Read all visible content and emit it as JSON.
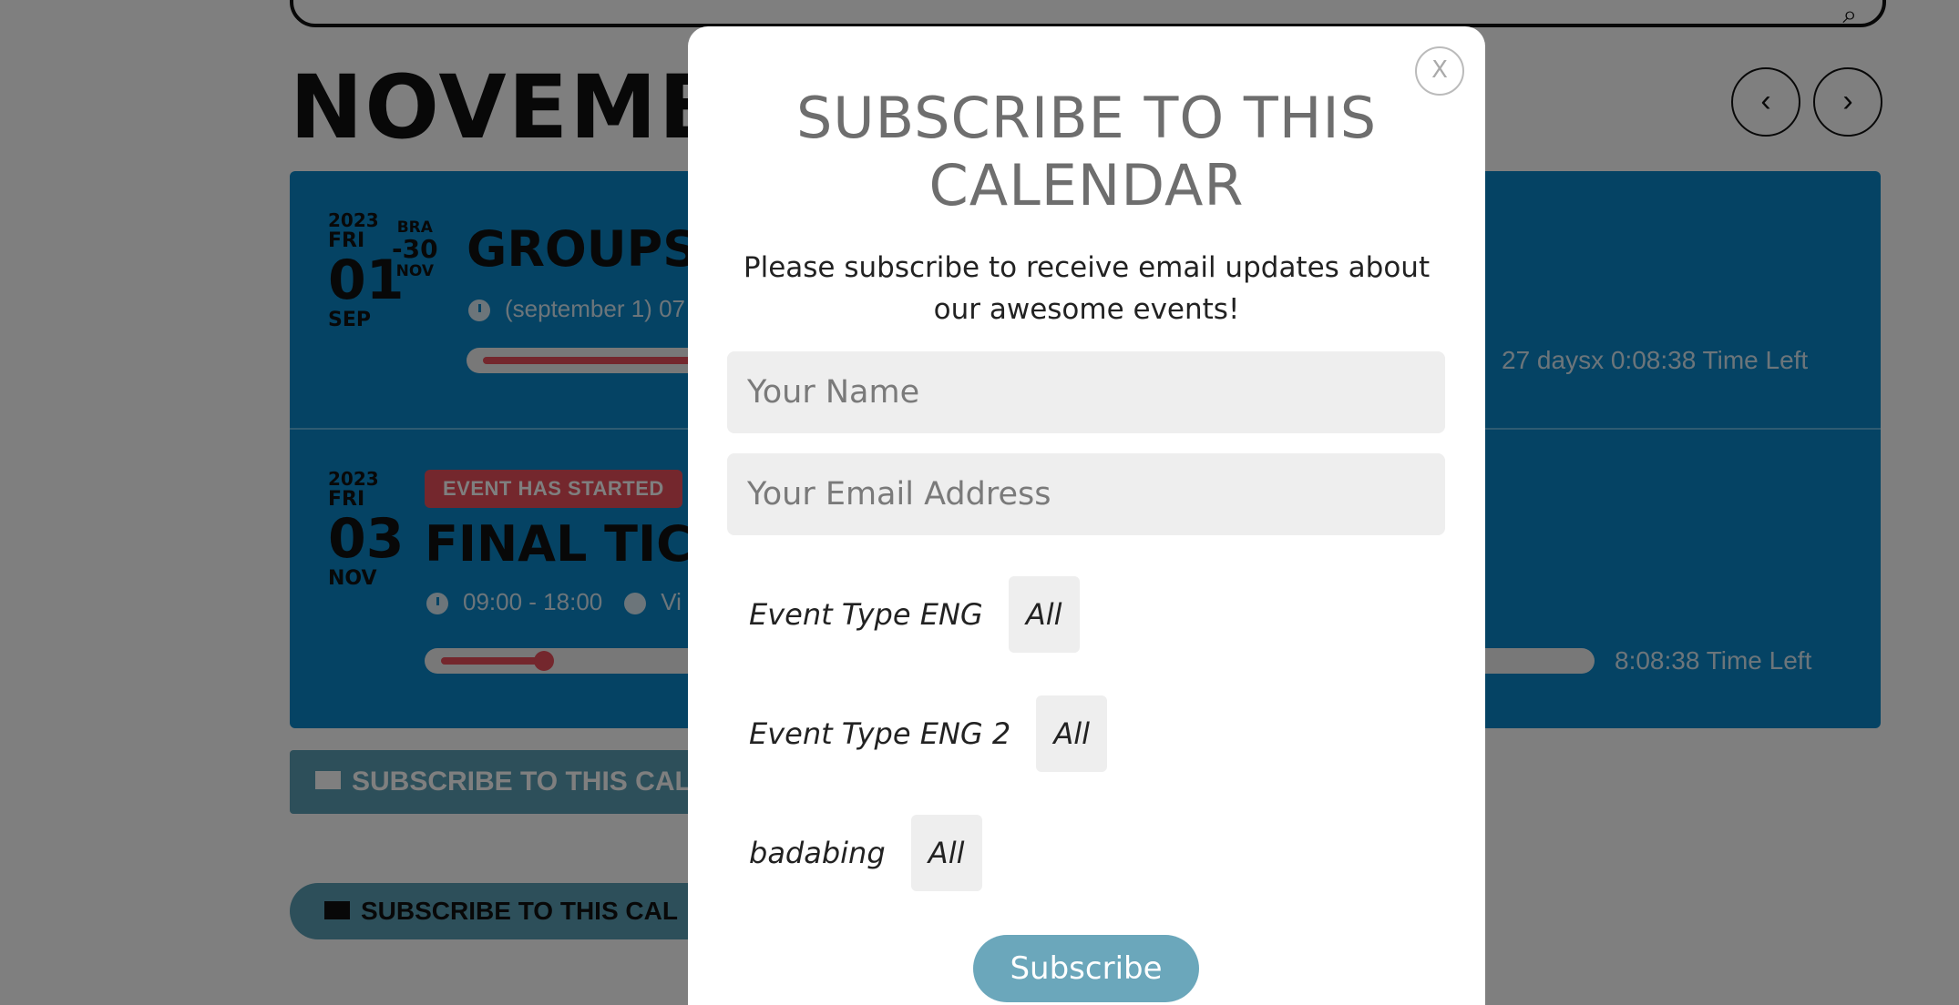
{
  "background": {
    "month_title": "NOVEMB",
    "events": [
      {
        "year": "2023",
        "dow": "FRI",
        "day": "01",
        "month": "SEP",
        "end_top": "BRA",
        "end_day": "-30",
        "end_month": "NOV",
        "title": "GROUPS",
        "meta": "(september 1) 07",
        "time_left": "27 daysx 0:08:38 Time Left"
      },
      {
        "year": "2023",
        "dow": "FRI",
        "day": "03",
        "month": "NOV",
        "badge": "EVENT HAS STARTED",
        "title": "FINAL TICK",
        "time": "09:00 - 18:00",
        "location": "Vi",
        "time_left": "8:08:38 Time Left"
      }
    ],
    "subscribe_button_1": "SUBSCRIBE TO THIS CAL",
    "subscribe_button_2": "SUBSCRIBE TO THIS CAL",
    "nav_prev_icon": "chevron-left-icon",
    "nav_next_icon": "chevron-right-icon"
  },
  "modal": {
    "close_label": "X",
    "title": "SUBSCRIBE TO THIS CALENDAR",
    "description": "Please subscribe to receive email updates about our awesome events!",
    "name_placeholder": "Your Name",
    "email_placeholder": "Your Email Address",
    "filters": [
      {
        "label": "Event Type ENG",
        "value": "All"
      },
      {
        "label": "Event Type ENG 2",
        "value": "All"
      },
      {
        "label": "badabing",
        "value": "All"
      }
    ],
    "subscribe_label": "Subscribe"
  },
  "colors": {
    "event_blue": "#0b87c9",
    "accent_red": "#e94e5a",
    "button_teal": "#6ba7bb"
  }
}
